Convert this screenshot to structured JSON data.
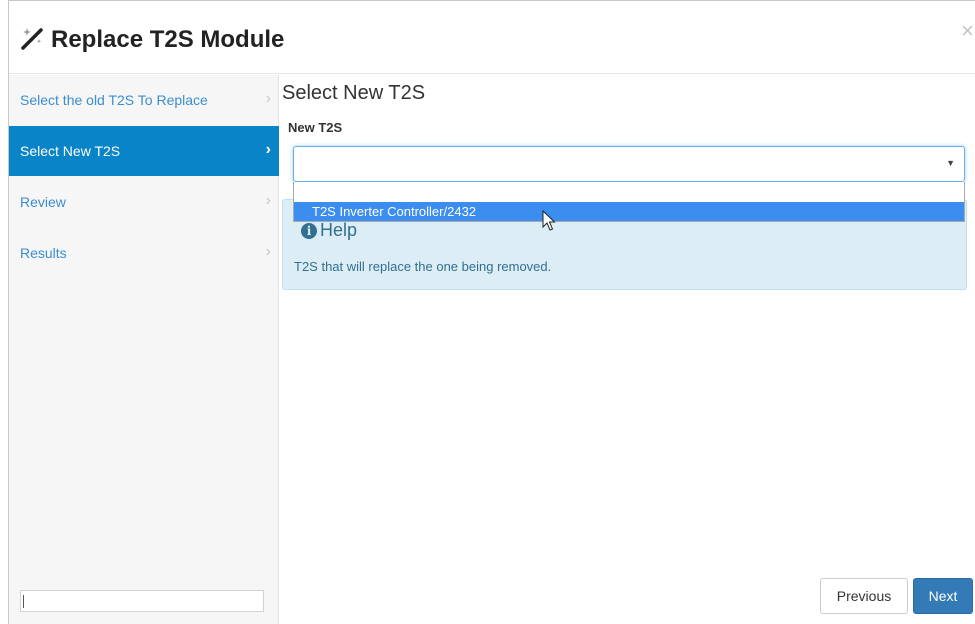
{
  "modal": {
    "title": "Replace T2S Module",
    "close_glyph": "×",
    "icons": {
      "title_icon": "magic-wand-icon",
      "close_icon": "close-icon"
    }
  },
  "sidebar": {
    "steps": [
      {
        "label": "Select the old T2S To Replace",
        "chevron": "›",
        "active": false
      },
      {
        "label": "Select New T2S",
        "chevron": "›",
        "active": true
      },
      {
        "label": "Review",
        "chevron": "›",
        "active": false
      },
      {
        "label": "Results",
        "chevron": "›",
        "active": false
      }
    ],
    "bottom_input_value": ""
  },
  "main": {
    "page_title": "Select New T2S",
    "field_label": "New T2S",
    "select": {
      "value": "",
      "arrow": "▼"
    },
    "dropdown": {
      "search_value": "",
      "options": [
        "T2S Inverter Controller/2432"
      ],
      "highlighted_index": 0
    },
    "help": {
      "title": "Help",
      "icon": "info-icon",
      "info_glyph": "i",
      "text": "T2S that will replace the one being removed."
    }
  },
  "footer": {
    "previous_label": "Previous",
    "next_label": "Next"
  },
  "colors": {
    "active_step_bg": "#0a84c8",
    "link": "#3a8ed0",
    "help_bg": "#dcedf6",
    "help_text": "#31708f",
    "option_highlight": "#3b8df0",
    "primary_button": "#337ab7"
  }
}
